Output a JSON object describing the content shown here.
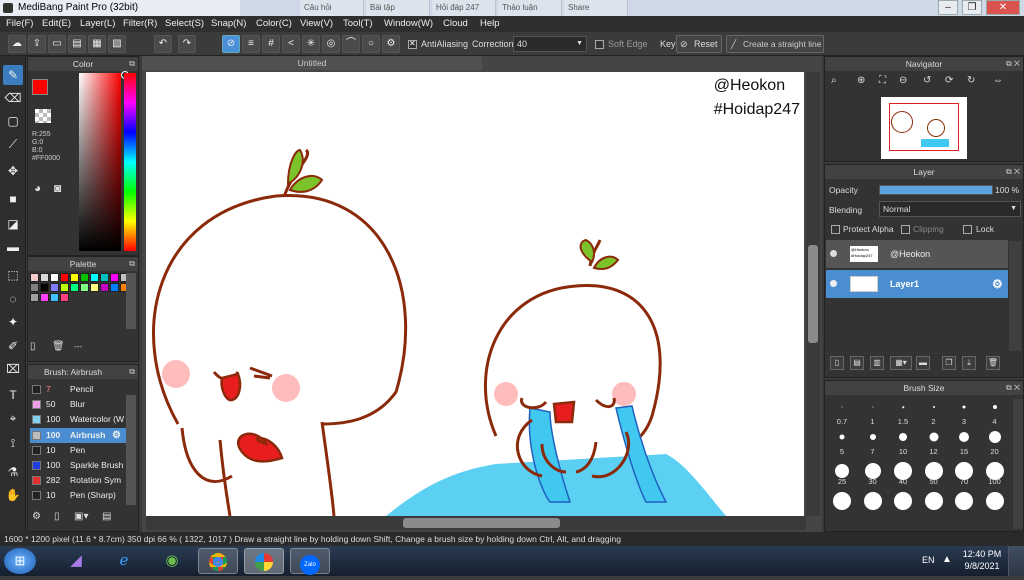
{
  "window": {
    "title": "MediBang Paint Pro (32bit)"
  },
  "browser_tabs": [
    "Câu hỏi",
    "Bài tập",
    "Hỏi đáp 247",
    "Thảo luận",
    "Share"
  ],
  "menu": [
    "File(F)",
    "Edit(E)",
    "Layer(L)",
    "Filter(R)",
    "Select(S)",
    "Snap(N)",
    "Color(C)",
    "View(V)",
    "Tool(T)",
    "Window(W)",
    "Cloud",
    "Help"
  ],
  "toolbar": {
    "antialiasing": "AntiAliasing",
    "correction_label": "Correction",
    "correction_value": "40",
    "soft_edge": "Soft Edge",
    "key_label": "Key",
    "reset_label": "Reset",
    "straight_line_label": "Create a straight line"
  },
  "document": {
    "tab_title": "Untitled"
  },
  "canvas": {
    "watermark_line1": "@Heokon",
    "watermark_line2": "#Hoidap247"
  },
  "color_panel": {
    "title": "Color",
    "r": "R:255",
    "g": "G:0",
    "b": "B:0",
    "hex": "#FF0000",
    "primary": "#ff0000",
    "secondary": "#ffffff"
  },
  "palette_panel": {
    "title": "Palette",
    "footer": "---",
    "colors": [
      "#f7c9c9",
      "#d8d8d8",
      "#ffffff",
      "#ff0000",
      "#ffff00",
      "#00c000",
      "#00ffff",
      "#00c0c0",
      "#ff00ff",
      "#c0c0c0",
      "#808080",
      "#000000",
      "#8080ff",
      "#c0ff00",
      "#00ff80",
      "#80ff80",
      "#ffff80",
      "#c000c0",
      "#0080ff",
      "#ff8000",
      "#a0a0a0",
      "#ff40ff",
      "#40c0ff",
      "#ff4080"
    ]
  },
  "brush_panel": {
    "title": "Brush: Airbrush",
    "items": [
      {
        "size": "7",
        "name": "Pencil",
        "color": "#222222"
      },
      {
        "size": "50",
        "name": "Blur",
        "color": "#f0a0e8"
      },
      {
        "size": "100",
        "name": "Watercolor (W",
        "color": "#80d0f0"
      },
      {
        "size": "100",
        "name": "Airbrush",
        "color": "#bbbbbb",
        "selected": true
      },
      {
        "size": "10",
        "name": "Pen",
        "color": "#222222"
      },
      {
        "size": "100",
        "name": "Sparkle Brush",
        "color": "#2040e0"
      },
      {
        "size": "282",
        "name": "Rotation Sym",
        "color": "#e03030"
      },
      {
        "size": "10",
        "name": "Pen (Sharp)",
        "color": "#222222"
      }
    ]
  },
  "navigator_panel": {
    "title": "Navigator"
  },
  "layer_panel": {
    "title": "Layer",
    "opacity_label": "Opacity",
    "opacity_value": "100 %",
    "opacity_fraction": 1.0,
    "blending_label": "Blending",
    "blending_value": "Normal",
    "protect_alpha": "Protect Alpha",
    "clipping": "Clipping",
    "lock": "Lock",
    "layers": [
      {
        "name": "@Heokon",
        "thumb_text": "@Heokon #Hoidap247",
        "selected": false
      },
      {
        "name": "Layer1",
        "selected": true
      }
    ]
  },
  "brush_size_panel": {
    "title": "Brush Size",
    "sizes": [
      "0.7",
      "1",
      "1.5",
      "2",
      "3",
      "4",
      "5",
      "7",
      "10",
      "12",
      "15",
      "20",
      "25",
      "30",
      "40",
      "50",
      "70",
      "100",
      "150",
      "200",
      "250",
      "300",
      "350",
      "400"
    ]
  },
  "status": {
    "text": "1600 * 1200 pixel   (11.6 * 8.7cm)   350 dpi   66 %   ( 1322, 1017 )   Draw a straight line by holding down Shift, Change a brush size by holding down Ctrl, Alt, and dragging"
  },
  "taskbar": {
    "apps": [
      "start",
      "visual-studio",
      "internet-explorer",
      "downloader",
      "chrome",
      "medibang",
      "zalo"
    ],
    "zalo_label": "Zalo",
    "language": "EN",
    "time": "12:40 PM",
    "date": "9/8/2021"
  }
}
